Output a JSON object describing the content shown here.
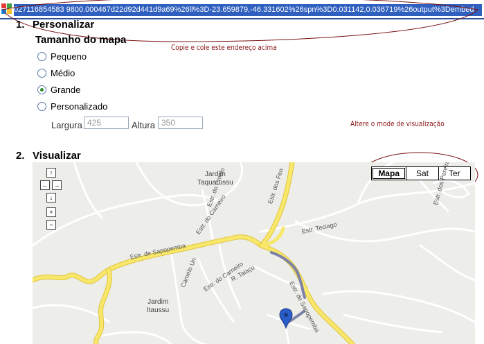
{
  "url_bar": {
    "url": "027116854583 9800.000467d22d92d441d9a69%26ll%3D-23.659879,-46.331602%26spn%3D0.031142,0.036719%26output%3Dembed"
  },
  "section1": {
    "number": "1.",
    "title": "Personalizar"
  },
  "map_size": {
    "title": "Tamanho do mapa",
    "options": [
      {
        "label": "Pequeno",
        "checked": false
      },
      {
        "label": "Médio",
        "checked": false
      },
      {
        "label": "Grande",
        "checked": true
      },
      {
        "label": "Personalizado",
        "checked": false
      }
    ],
    "width_label": "Largura",
    "width_value": "425",
    "height_label": "Altura",
    "height_value": "350"
  },
  "annotations": {
    "copy_hint": "Copie e cole este endereço acima",
    "view_hint": "Altere o mode de visualização"
  },
  "section2": {
    "number": "2.",
    "title": "Visualizar"
  },
  "map": {
    "nav": {
      "up": "↑",
      "left": "←",
      "right": "→",
      "down": "↓",
      "zoom_in": "+",
      "zoom_out": "−"
    },
    "map_types": [
      "Mapa",
      "Sat",
      "Ter"
    ],
    "selected_type": "Mapa",
    "places": {
      "taquarussu_1": "Jardim",
      "taquarussu_2": "Taquarussu",
      "itaussu_1": "Jardim",
      "itaussu_2": "Itaussu"
    },
    "roads": {
      "sapopemba_1": "Estr. de Sapopemba",
      "sapopemba_2": "Estr. de Sapopemba",
      "fen": "Estr. dos Fen",
      "carneiro_1": "Estr. do Carneiro",
      "carneiro_2": "Estr. do Carneiro",
      "camelo": "Estr. do Cmelo",
      "camelo_un": "Camelo Un",
      "teciago": "Estr. Teciago",
      "taiacu": "R. Taiaçu",
      "pereira": "Estr. dos Pereira"
    },
    "colors": {
      "major_road": "#f7e86b",
      "major_road_edge": "#e3c33b",
      "route": "#7b82a8",
      "marker": "#2a5dc8"
    }
  }
}
